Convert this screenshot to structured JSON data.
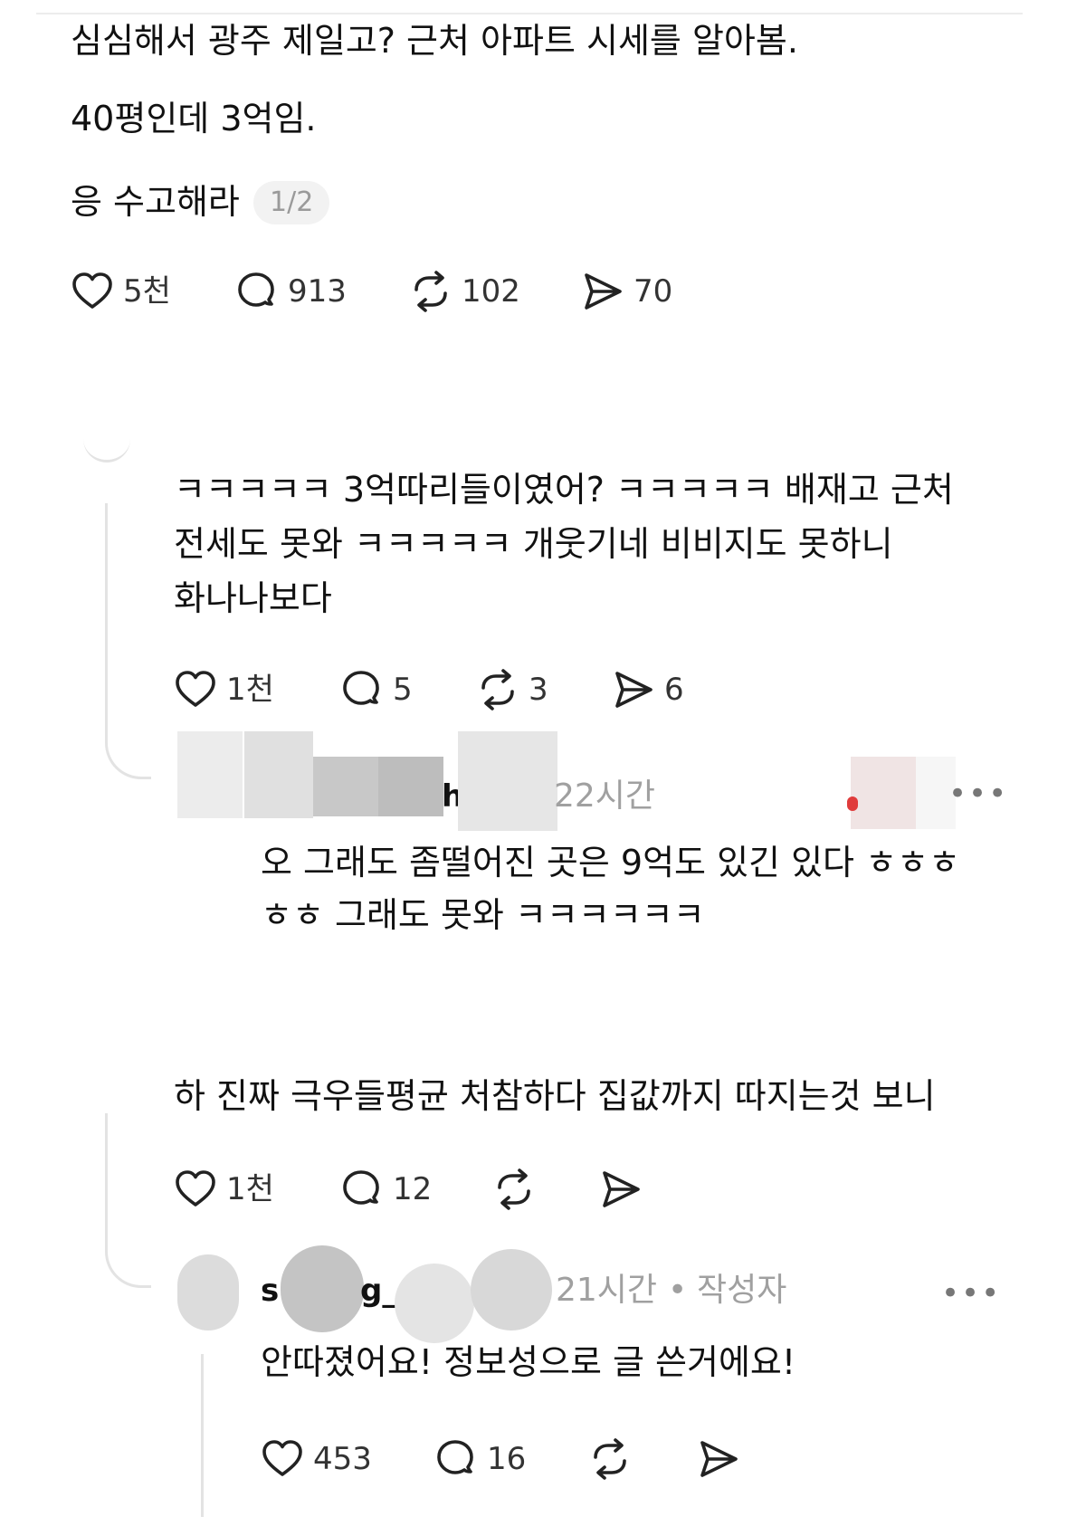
{
  "post": {
    "lines": [
      "심심해서 광주 제일고? 근처 아파트 시세를 알아봄.",
      "40평인데 3억임.",
      "응 수고해라"
    ],
    "page_indicator": "1/2",
    "likes": "5천",
    "replies": "913",
    "reposts": "102",
    "shares": "70"
  },
  "reply1": {
    "lines": [
      "ㅋㅋㅋㅋㅋ 3억따리들이였어? ㅋㅋㅋㅋㅋ 배재고 근처",
      "전세도 못와 ㅋㅋㅋㅋㅋ 개웃기네 비비지도 못하니",
      "화나나보다"
    ],
    "likes": "1천",
    "replies": "5",
    "reposts": "3",
    "shares": "6"
  },
  "reply2": {
    "username_visible": "h",
    "time": "22시간",
    "lines": [
      "오 그래도 좀떨어진 곳은 9억도 있긴 있다 ㅎㅎㅎ",
      "ㅎㅎ 그래도 못와 ㅋㅋㅋㅋㅋㅋ"
    ]
  },
  "reply3": {
    "lines": [
      "하 진짜 극우들평균 처참하다 집값까지 따지는것 보니"
    ],
    "likes": "1천",
    "replies": "12"
  },
  "reply4": {
    "username_start": "s",
    "username_mid": "g_",
    "time": "21시간",
    "separator": "•",
    "author_label": "작성자",
    "lines": [
      "안따졌어요! 정보성으로 글 쓴거에요!"
    ],
    "likes": "453",
    "replies": "16"
  },
  "colors": {
    "text": "#111111",
    "muted": "#a0a0a0",
    "line": "#e3e3e3",
    "badge_bg": "#f2f2f2"
  },
  "icons": [
    "heart-icon",
    "reply-icon",
    "repost-icon",
    "share-icon",
    "more-icon"
  ]
}
